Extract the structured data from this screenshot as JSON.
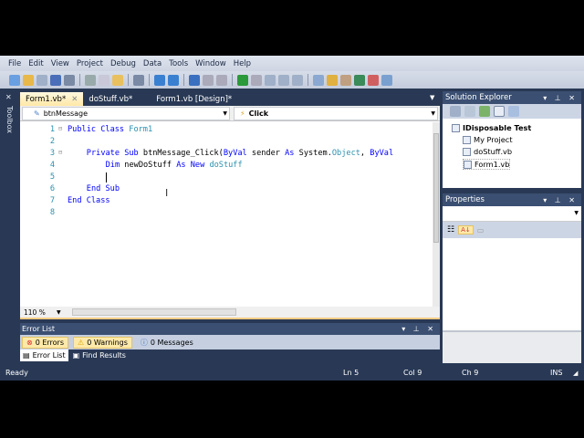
{
  "menu": [
    "File",
    "Edit",
    "View",
    "Project",
    "Debug",
    "Data",
    "Tools",
    "Window",
    "Help"
  ],
  "side_toolbox_label": "Toolbox",
  "doc_tabs": [
    {
      "label": "Form1.vb*",
      "active": true
    },
    {
      "label": "doStuff.vb*",
      "active": false
    },
    {
      "label": "Form1.vb [Design]*",
      "active": false
    }
  ],
  "nav": {
    "object": "btnMessage",
    "event": "Click"
  },
  "code_lines": [
    {
      "n": "1",
      "parts": [
        [
          "kw",
          "Public Class "
        ],
        [
          "ty",
          "Form1"
        ]
      ],
      "indent": 0
    },
    {
      "n": "2",
      "parts": [],
      "indent": 0
    },
    {
      "n": "3",
      "parts": [
        [
          "kw",
          "Private Sub "
        ],
        [
          "",
          "btnMessage_Click("
        ],
        [
          "kw",
          "ByVal "
        ],
        [
          "",
          "sender "
        ],
        [
          "kw",
          "As "
        ],
        [
          "",
          "System."
        ],
        [
          "ty",
          "Object"
        ],
        [
          "",
          ", "
        ],
        [
          "kw",
          "ByVal"
        ]
      ],
      "indent": 4
    },
    {
      "n": "4",
      "parts": [
        [
          "kw",
          "Dim "
        ],
        [
          "",
          "newDoStuff "
        ],
        [
          "kw",
          "As New "
        ],
        [
          "ty",
          "doStuff"
        ]
      ],
      "indent": 8
    },
    {
      "n": "5",
      "parts": [],
      "indent": 8
    },
    {
      "n": "6",
      "parts": [
        [
          "kw",
          "End Sub"
        ]
      ],
      "indent": 4
    },
    {
      "n": "7",
      "parts": [
        [
          "kw",
          "End Class"
        ]
      ],
      "indent": 0
    },
    {
      "n": "8",
      "parts": [],
      "indent": 0
    }
  ],
  "zoom": "110 %",
  "error_list": {
    "title": "Error List",
    "errors": "0 Errors",
    "warnings": "0 Warnings",
    "messages": "0 Messages",
    "tabs": [
      "Error List",
      "Find Results"
    ]
  },
  "solution_explorer": {
    "title": "Solution Explorer",
    "items": [
      {
        "label": "IDisposable Test",
        "bold": true
      },
      {
        "label": "My Project"
      },
      {
        "label": "doStuff.vb"
      },
      {
        "label": "Form1.vb",
        "selected": true
      }
    ]
  },
  "properties": {
    "title": "Properties"
  },
  "status": {
    "text": "Ready",
    "ln": "Ln 5",
    "col": "Col 9",
    "ch": "Ch 9",
    "mode": "INS"
  }
}
